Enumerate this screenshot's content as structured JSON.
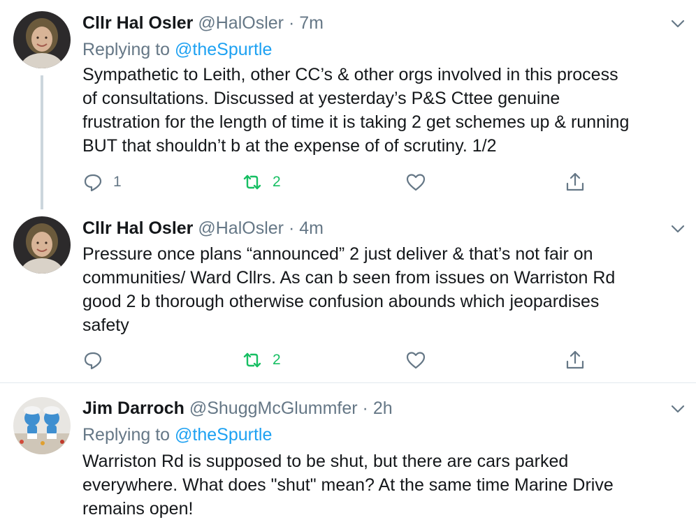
{
  "tweets": [
    {
      "name": "Cllr Hal Osler",
      "handle": "@HalOsler",
      "separator": "·",
      "time": "7m",
      "replying_prefix": "Replying to",
      "replying_to": "@theSpurtle",
      "text_lines": [
        "Sympathetic to Leith, other CC’s &  other orgs involved in this process",
        "of consultations. Discussed  at yesterday’s P&S Cttee genuine",
        "frustration for the length of time it is taking 2 get schemes up & running",
        "BUT that shouldn’t b at the expense of of scrutiny. 1/2"
      ],
      "reply_count": "1",
      "retweet_count": "2",
      "like_count": ""
    },
    {
      "name": "Cllr Hal Osler",
      "handle": "@HalOsler",
      "separator": "·",
      "time": "4m",
      "text_lines": [
        "Pressure once plans “announced” 2 just deliver & that’s not fair on",
        "communities/ Ward Cllrs. As can b seen from issues on Warriston Rd",
        "good 2 b thorough otherwise confusion abounds which jeopardises",
        "safety"
      ],
      "reply_count": "",
      "retweet_count": "2",
      "like_count": ""
    },
    {
      "name": "Jim Darroch",
      "handle": "@ShuggMcGlummfer",
      "separator": "·",
      "time": "2h",
      "replying_prefix": "Replying to",
      "replying_to": "@theSpurtle",
      "text_lines": [
        "Warriston Rd is supposed to be shut, but there are cars parked",
        "everywhere. What does \"shut\" mean? At the same time Marine Drive",
        "remains open!"
      ]
    }
  ],
  "icons": {
    "reply": "reply-icon",
    "retweet": "retweet-icon",
    "like": "heart-icon",
    "share": "share-icon",
    "more": "chevron-down-icon"
  },
  "colors": {
    "text": "#14171a",
    "muted": "#657786",
    "link": "#1da1f2",
    "retweet_active": "#17bf63",
    "border": "#e1e8ed"
  }
}
